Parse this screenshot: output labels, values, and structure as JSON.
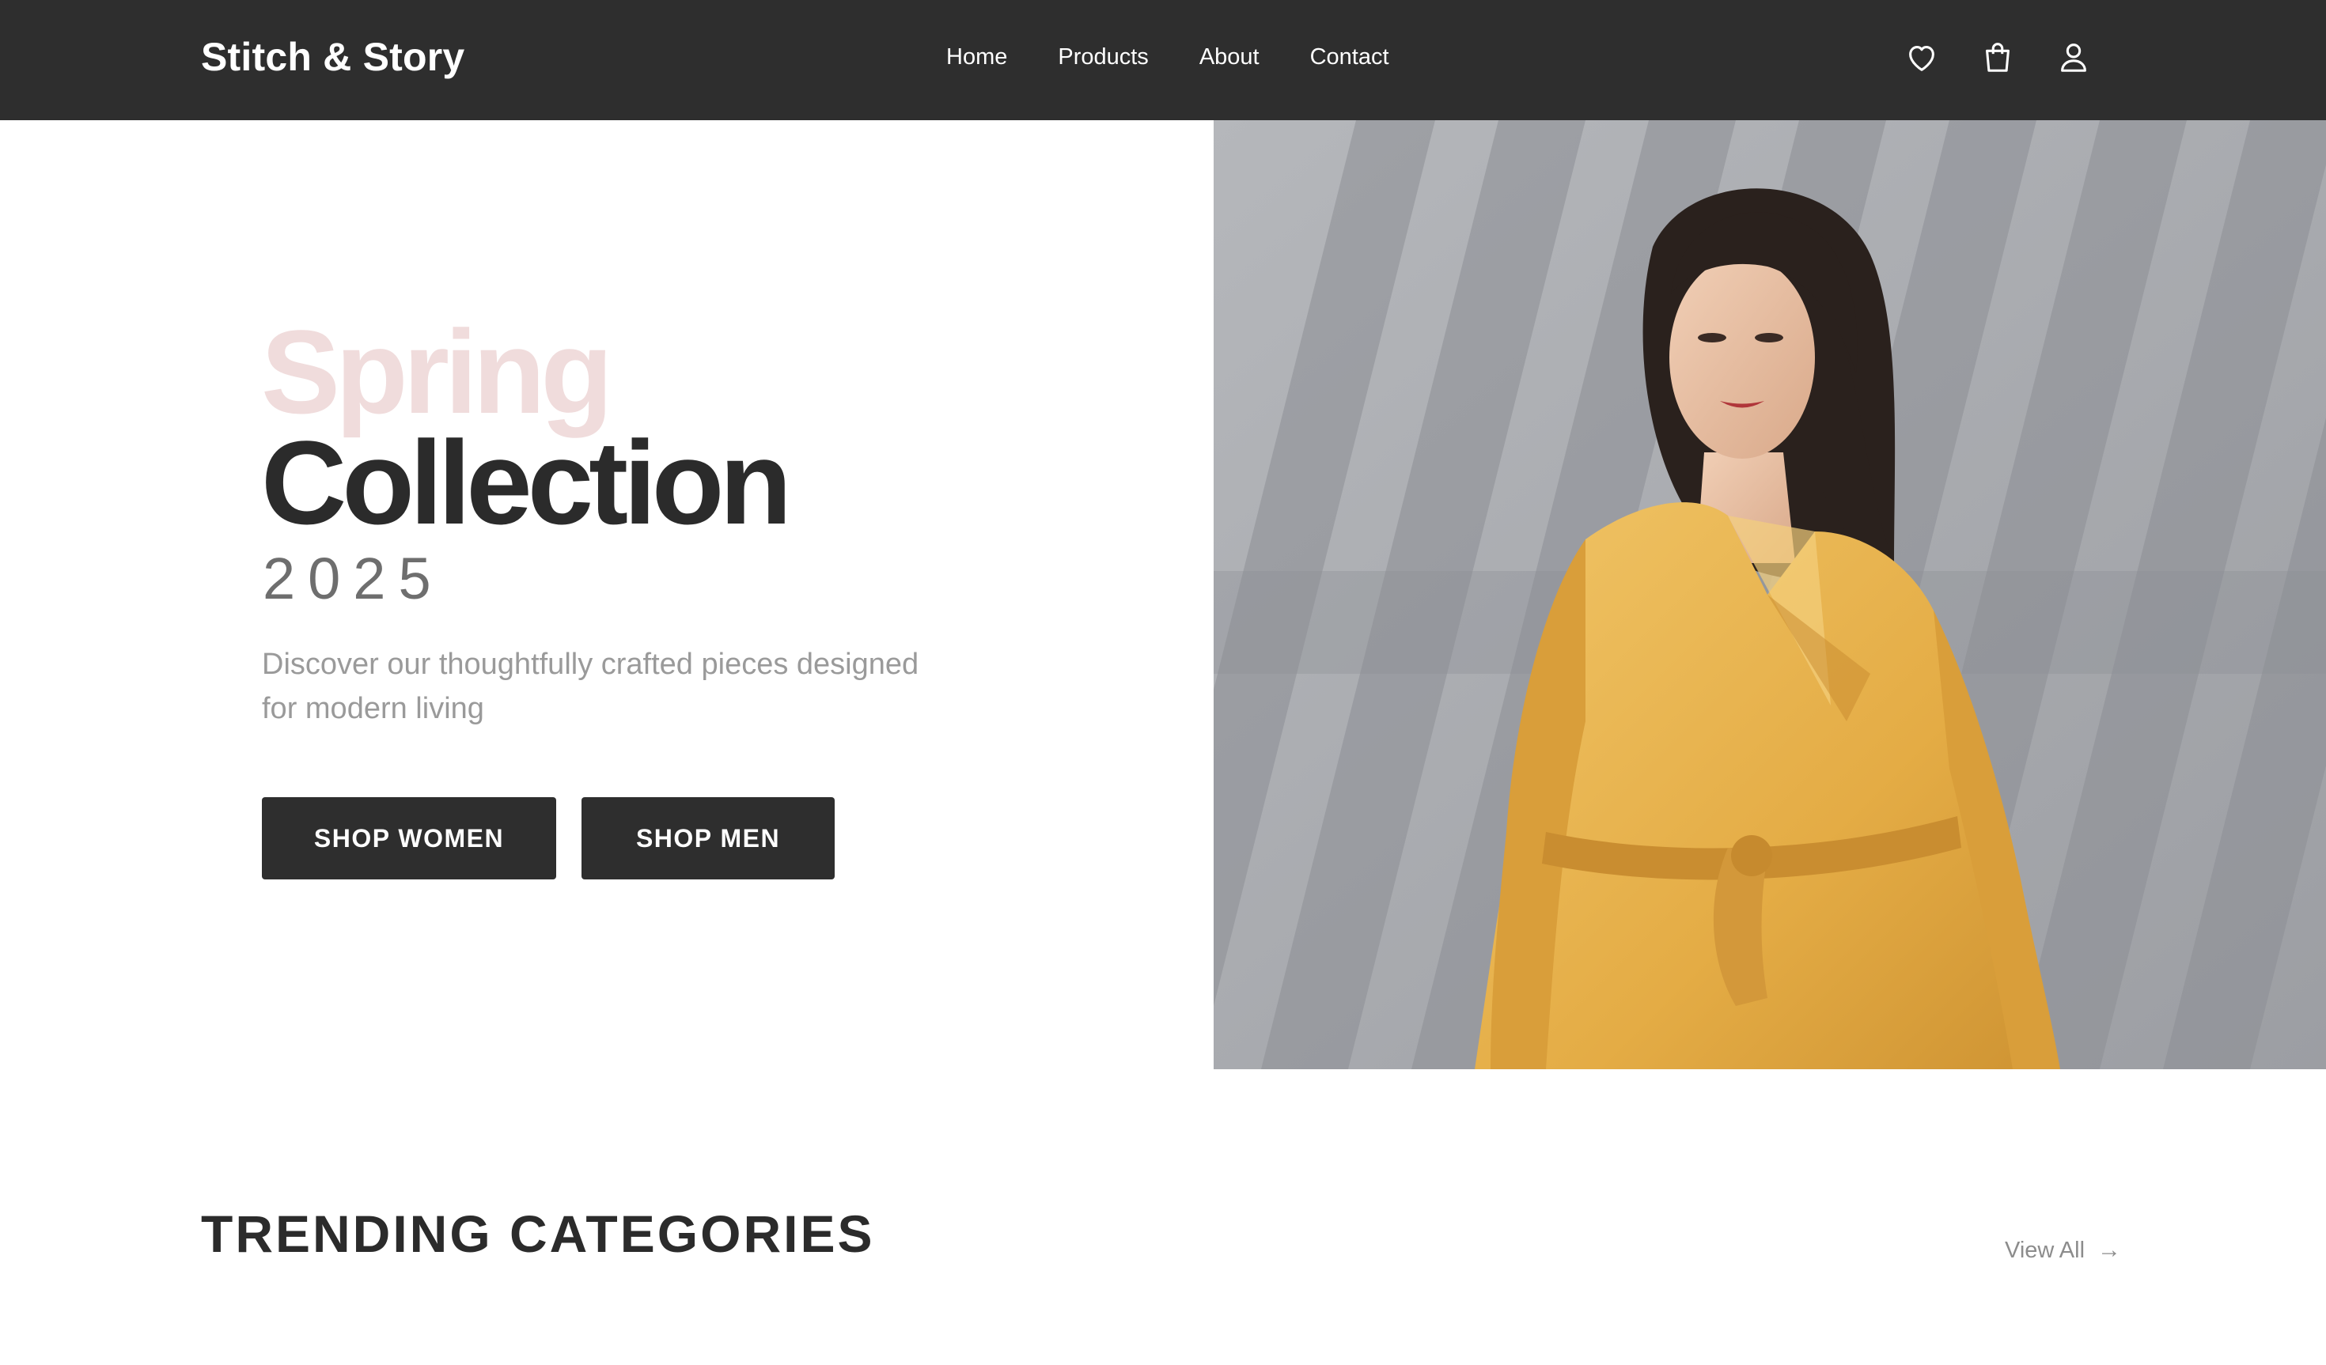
{
  "header": {
    "brand": "Stitch & Story",
    "nav": [
      "Home",
      "Products",
      "About",
      "Contact"
    ],
    "icons": [
      "heart-icon",
      "shopping-bag-icon",
      "user-icon"
    ]
  },
  "hero": {
    "title_line1": "Spring",
    "title_line2": "Collection",
    "year": "2025",
    "description": "Discover our thoughtfully crafted pieces designed for modern living",
    "buttons": {
      "women": "SHOP WOMEN",
      "men": "SHOP MEN"
    }
  },
  "trending": {
    "title": "TRENDING CATEGORIES",
    "view_all": "View All",
    "arrow": "→"
  },
  "colors": {
    "header_bg": "#2e2e2e",
    "accent_pink": "#f0dcdc",
    "button_bg": "#2e2e2e",
    "dress_yellow": "#e9b84f"
  }
}
